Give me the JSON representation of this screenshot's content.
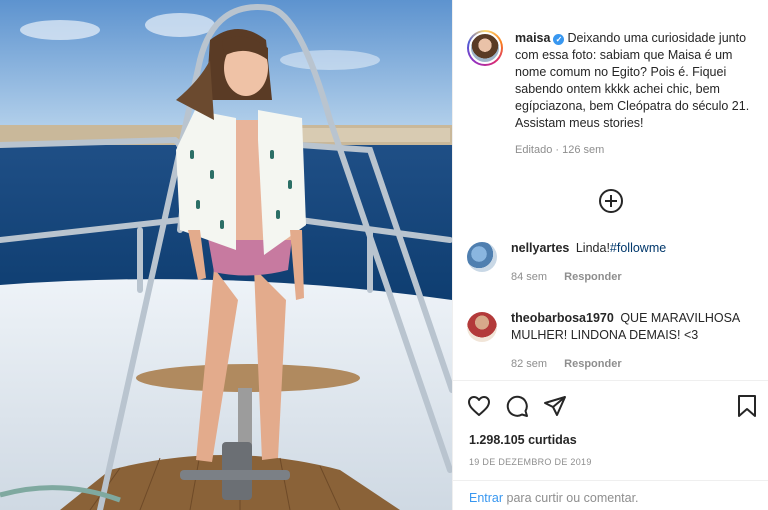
{
  "post": {
    "username": "maisa",
    "verified_glyph": "✓",
    "caption": "Deixando uma curiosidade junto com essa foto: sabiam que Maisa é um nome comum no Egito? Pois é. Fiquei sabendo ontem kkkk achei chic, bem egípciazona, bem Cleópatra do século 21. Assistam meus stories!",
    "edited_meta": "Editado · 126 sem"
  },
  "comments": [
    {
      "username": "nellyartes",
      "text": "Linda!",
      "hashtag": "#followme",
      "time": "84 sem",
      "reply_label": "Responder"
    },
    {
      "username": "theobarbosa1970",
      "text": "QUE MARAVILHOSA MULHER! LINDONA DEMAIS! <3",
      "hashtag": "",
      "time": "82 sem",
      "reply_label": "Responder"
    }
  ],
  "stats": {
    "likes": "1.298.105 curtidas",
    "date": "19 DE DEZEMBRO DE 2019"
  },
  "login_prompt": {
    "link": "Entrar",
    "text": " para curtir ou comentar."
  },
  "icons": [
    "more-comments-plus-icon",
    "like-heart-icon",
    "comment-bubble-icon",
    "share-send-icon",
    "save-bookmark-icon"
  ],
  "colors": {
    "accent_blue": "#3897f0",
    "muted": "#8e8e8e",
    "text": "#262626",
    "hashtag": "#00376b"
  }
}
